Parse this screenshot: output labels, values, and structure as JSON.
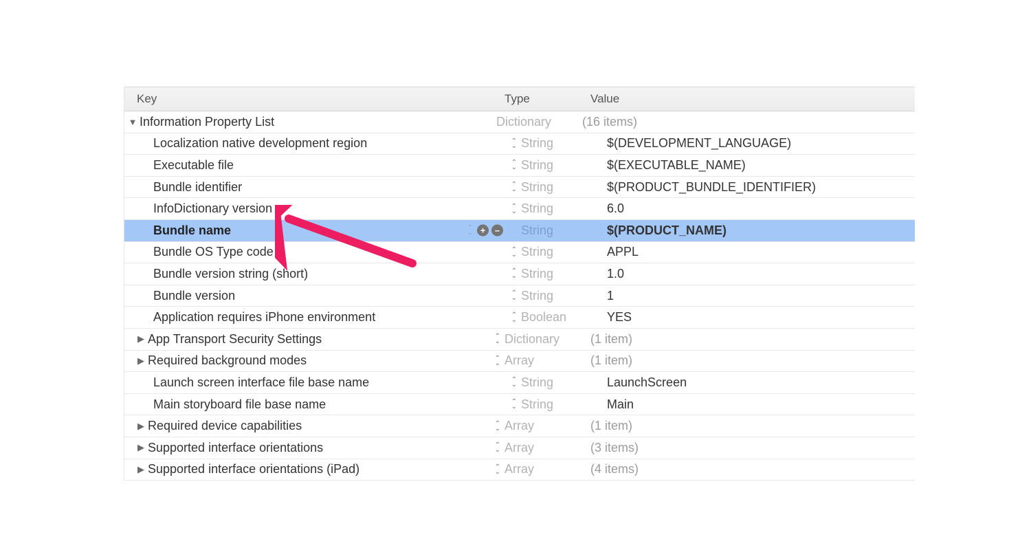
{
  "header": {
    "key": "Key",
    "type": "Type",
    "value": "Value"
  },
  "root": {
    "key": "Information Property List",
    "type": "Dictionary",
    "value": "(16 items)"
  },
  "rows": [
    {
      "key": "Localization native development region",
      "type": "String",
      "value": "$(DEVELOPMENT_LANGUAGE)",
      "grey": false,
      "disclosure": "",
      "selected": false
    },
    {
      "key": "Executable file",
      "type": "String",
      "value": "$(EXECUTABLE_NAME)",
      "grey": false,
      "disclosure": "",
      "selected": false
    },
    {
      "key": "Bundle identifier",
      "type": "String",
      "value": "$(PRODUCT_BUNDLE_IDENTIFIER)",
      "grey": false,
      "disclosure": "",
      "selected": false
    },
    {
      "key": "InfoDictionary version",
      "type": "String",
      "value": "6.0",
      "grey": false,
      "disclosure": "",
      "selected": false
    },
    {
      "key": "Bundle name",
      "type": "String",
      "value": "$(PRODUCT_NAME)",
      "grey": false,
      "disclosure": "",
      "selected": true
    },
    {
      "key": "Bundle OS Type code",
      "type": "String",
      "value": "APPL",
      "grey": false,
      "disclosure": "",
      "selected": false
    },
    {
      "key": "Bundle version string (short)",
      "type": "String",
      "value": "1.0",
      "grey": false,
      "disclosure": "",
      "selected": false
    },
    {
      "key": "Bundle version",
      "type": "String",
      "value": "1",
      "grey": false,
      "disclosure": "",
      "selected": false
    },
    {
      "key": "Application requires iPhone environment",
      "type": "Boolean",
      "value": "YES",
      "grey": false,
      "disclosure": "",
      "selected": false
    },
    {
      "key": "App Transport Security Settings",
      "type": "Dictionary",
      "value": "(1 item)",
      "grey": true,
      "disclosure": "right",
      "selected": false
    },
    {
      "key": "Required background modes",
      "type": "Array",
      "value": "(1 item)",
      "grey": true,
      "disclosure": "right",
      "selected": false
    },
    {
      "key": "Launch screen interface file base name",
      "type": "String",
      "value": "LaunchScreen",
      "grey": false,
      "disclosure": "",
      "selected": false
    },
    {
      "key": "Main storyboard file base name",
      "type": "String",
      "value": "Main",
      "grey": false,
      "disclosure": "",
      "selected": false
    },
    {
      "key": "Required device capabilities",
      "type": "Array",
      "value": "(1 item)",
      "grey": true,
      "disclosure": "right",
      "selected": false
    },
    {
      "key": "Supported interface orientations",
      "type": "Array",
      "value": "(3 items)",
      "grey": true,
      "disclosure": "right",
      "selected": false
    },
    {
      "key": "Supported interface orientations (iPad)",
      "type": "Array",
      "value": "(4 items)",
      "grey": true,
      "disclosure": "right",
      "selected": false
    }
  ]
}
